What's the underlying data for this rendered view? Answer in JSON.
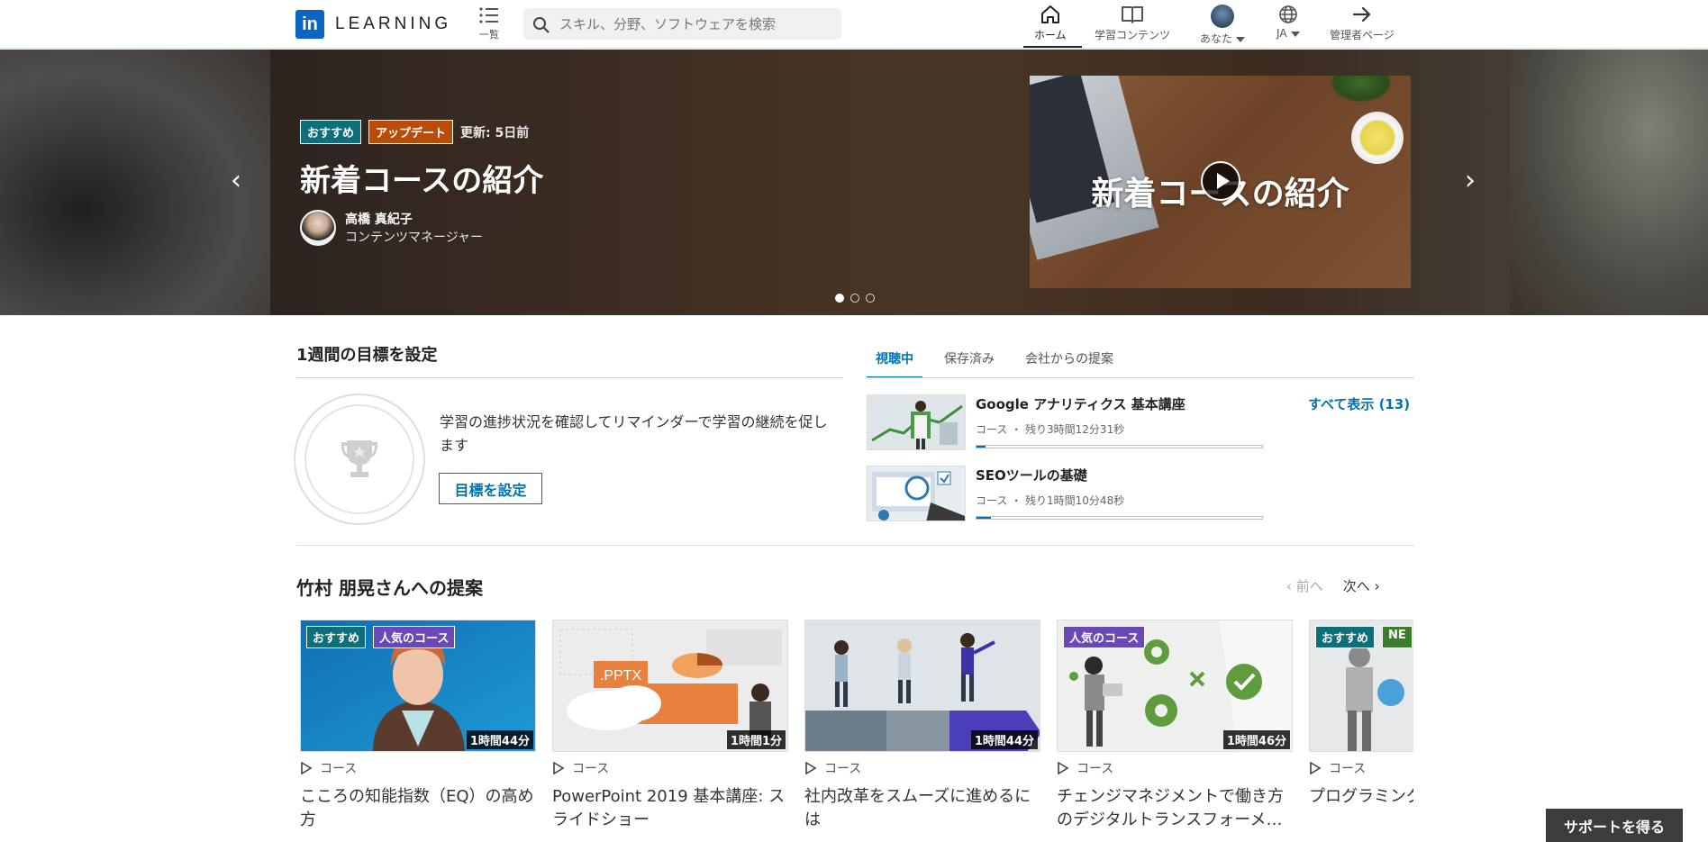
{
  "header": {
    "logo_mark": "in",
    "logo_text": "LEARNING",
    "browse_label": "一覧",
    "search_placeholder": "スキル、分野、ソフトウェアを検索",
    "nav": {
      "home": "ホーム",
      "content": "学習コンテンツ",
      "me": "あなた",
      "language": "JA",
      "admin": "管理者ページ"
    }
  },
  "hero": {
    "badge_recommended": "おすすめ",
    "badge_update": "アップデート",
    "updated": "更新: 5日前",
    "title": "新着コースの紹介",
    "author_name": "高橋 真紀子",
    "author_role": "コンテンツマネージャー",
    "video_title": "新着コースの紹介",
    "prev_arrow": "‹",
    "next_arrow": "›",
    "slide_count": 3,
    "active_slide": 1,
    "colors": {
      "recommended": "#0e6e7a",
      "update": "#b84d0a"
    }
  },
  "goal": {
    "title": "1週間の目標を設定",
    "text": "学習の進捗状況を確認してリマインダーで学習の継続を促します",
    "button": "目標を設定"
  },
  "tabs": {
    "items": [
      "視聴中",
      "保存済み",
      "会社からの提案"
    ],
    "active": 0
  },
  "watching": {
    "see_all": "すべて表示 (13)",
    "courses": [
      {
        "title": "Google アナリティクス 基本講座",
        "meta": "コース ・ 残り3時間12分31秒",
        "progress": 0.03
      },
      {
        "title": "SEOツールの基礎",
        "meta": "コース ・ 残り1時間10分48秒",
        "progress": 0.05
      }
    ]
  },
  "recommendations": {
    "title": "竹村 朋晃さんへの提案",
    "prev": "前へ",
    "next": "次へ",
    "cards": [
      {
        "badges": [
          "おすすめ",
          "人気のコース"
        ],
        "duration": "1時間44分",
        "type": "コース",
        "title": "こころの知能指数（EQ）の高め方"
      },
      {
        "badges": [],
        "duration": "1時間1分",
        "type": "コース",
        "title": "PowerPoint 2019 基本講座: スライドショー",
        "thumb_label": ".PPTX"
      },
      {
        "badges": [],
        "duration": "1時間44分",
        "type": "コース",
        "title": "社内改革をスムーズに進めるには"
      },
      {
        "badges": [
          "人気のコース"
        ],
        "duration": "1時間46分",
        "type": "コース",
        "title": "チェンジマネジメントで働き方のデジタルトランスフォーメ…"
      },
      {
        "badges": [
          "おすすめ",
          "NE"
        ],
        "duration": "",
        "type": "コース",
        "title": "プログラミング構造"
      }
    ]
  },
  "support_button": "サポートを得る"
}
